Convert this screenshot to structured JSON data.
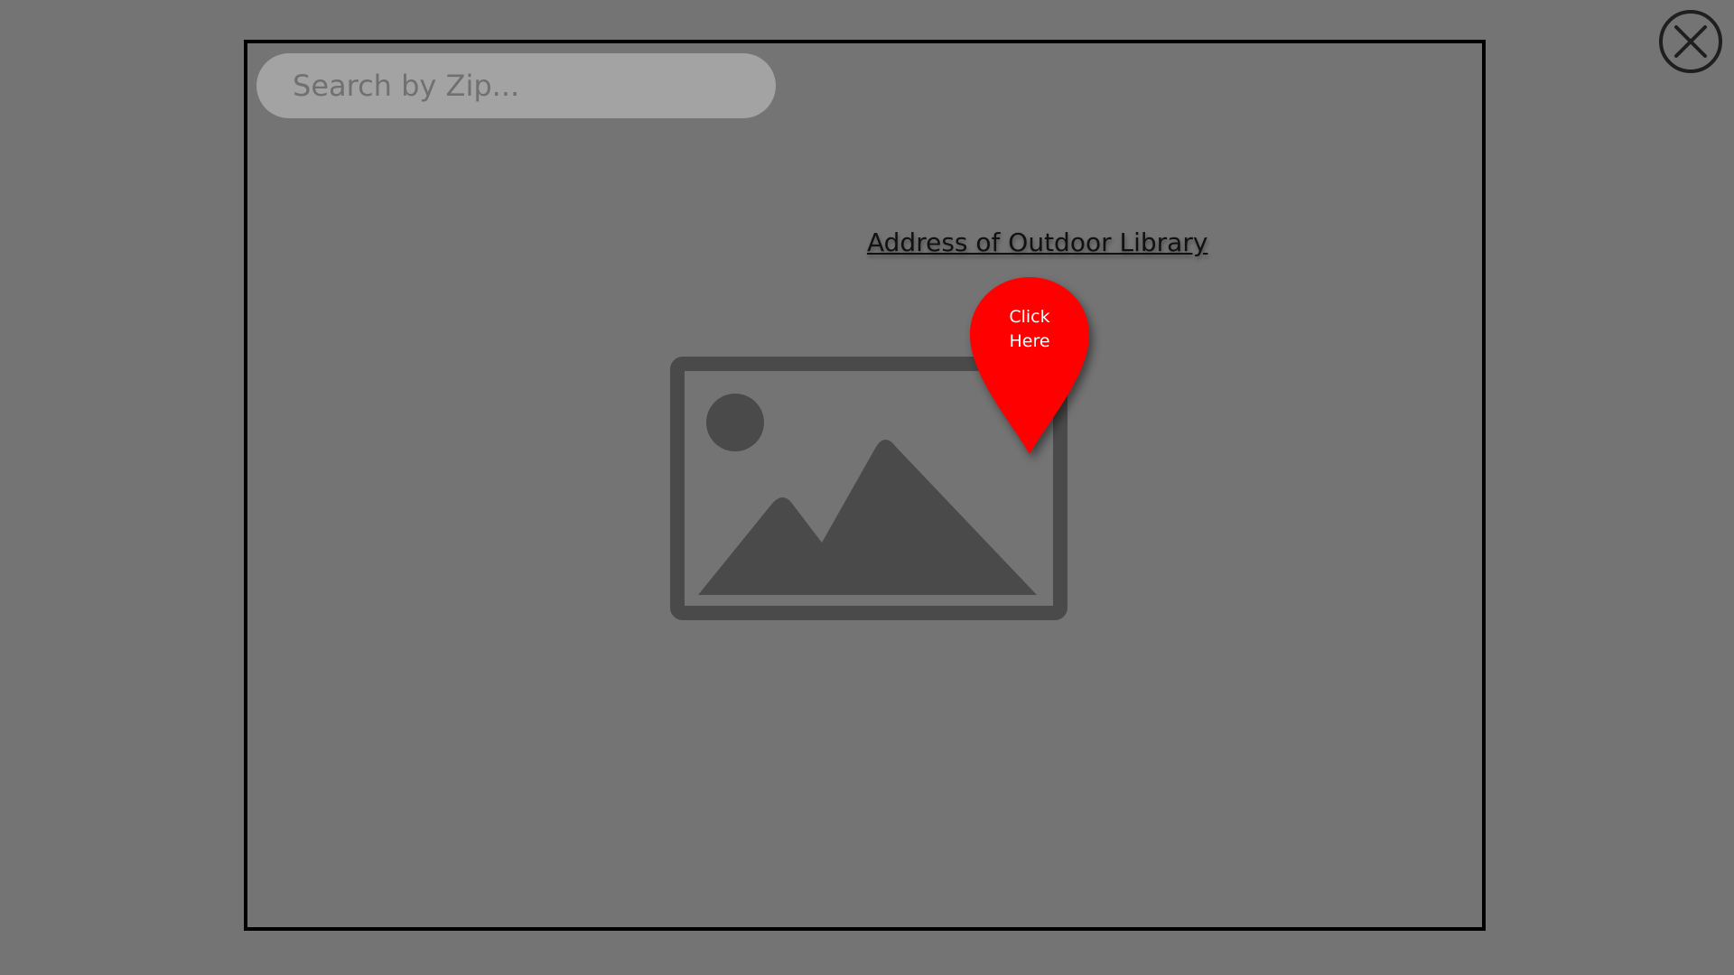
{
  "search": {
    "placeholder": "Search by Zip...",
    "value": ""
  },
  "map": {
    "address_link_label": "Address of Outdoor Library",
    "pin": {
      "line1": "Click",
      "line2": "Here",
      "color": "#ff0000"
    },
    "image_icon": "image-placeholder-icon"
  },
  "close_icon": "close-circle-icon",
  "colors": {
    "overlay": "#747474",
    "search_bg": "#a3a3a3",
    "pin": "#ff0000",
    "icon_dark": "#4a4a4a"
  }
}
